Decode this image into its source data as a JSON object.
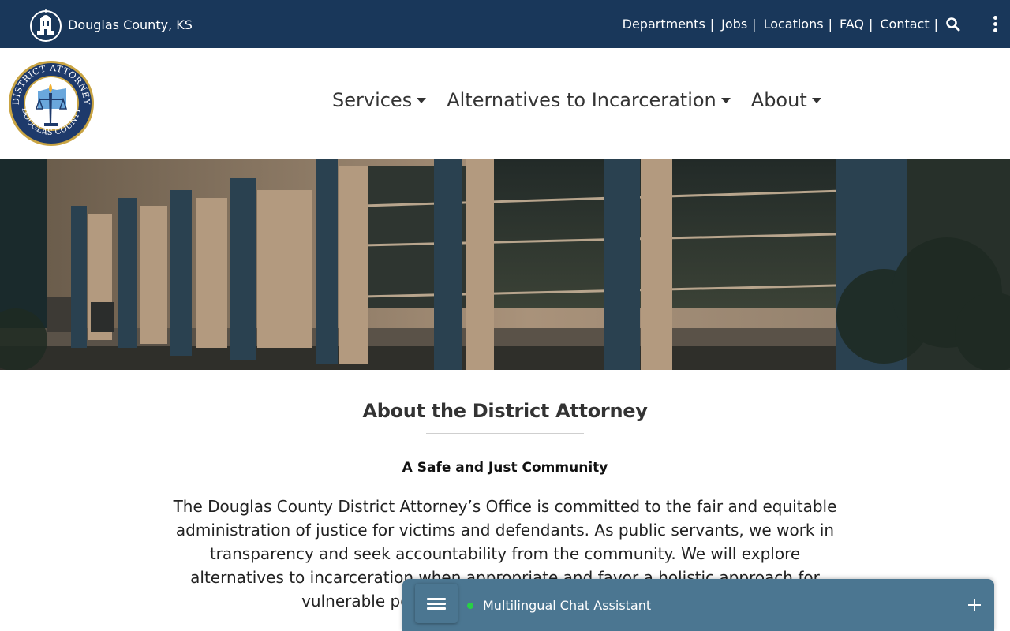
{
  "topbar": {
    "site_name": "Douglas County, KS",
    "icon": "courthouse-icon",
    "links": [
      "Departments",
      "Jobs",
      "Locations",
      "FAQ",
      "Contact"
    ],
    "separator": "|",
    "search_icon": "search-icon",
    "menu_icon": "kebab-menu-icon"
  },
  "header": {
    "logo": {
      "top_text": "DISTRICT ATTORNEY",
      "bottom_text": "DOUGLAS COUNTY"
    },
    "nav": [
      {
        "label": "Services"
      },
      {
        "label": "Alternatives to Incarceration"
      },
      {
        "label": "About"
      }
    ]
  },
  "hero": {
    "image": "building-at-night-photo"
  },
  "main": {
    "title": "About the District Attorney",
    "subtitle": "A Safe and Just Community",
    "body": "The Douglas County District Attorney’s Office is committed to the fair and equitable administration of justice for victims and defendants. As public servants, we work in transparency and seek accountability from the community. We will explore alternatives to incarceration when appropriate and favor a holistic approach for vulnerable populations entering the justice system."
  },
  "chat": {
    "title": "Multilingual Chat Assistant",
    "status_color": "#27d045",
    "menu_icon": "hamburger-icon",
    "expand_icon": "plus-icon"
  },
  "colors": {
    "topbar": "#19375a",
    "chat": "#4b7691",
    "seal_navy": "#1e3a6b",
    "seal_gold": "#c9a443"
  }
}
